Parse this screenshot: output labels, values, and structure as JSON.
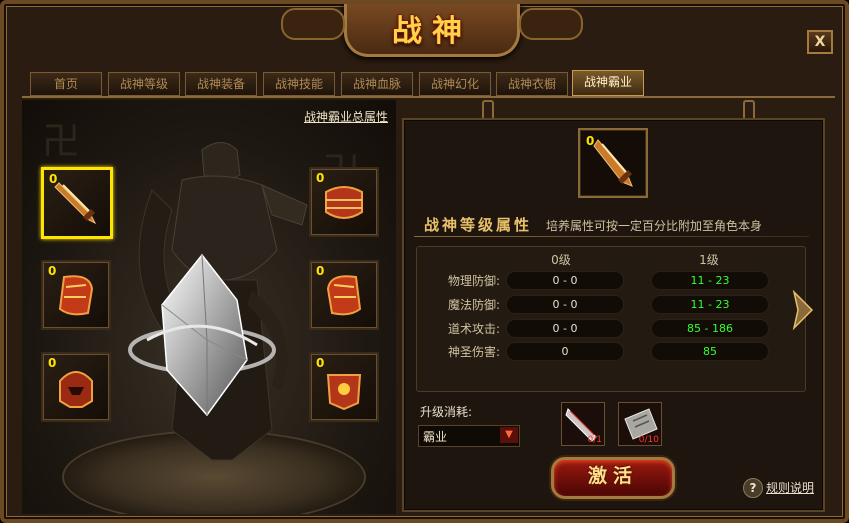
{
  "window": {
    "title": "战神",
    "close_label": "X"
  },
  "tabs": [
    {
      "label": "首页",
      "active": false
    },
    {
      "label": "战神等级",
      "active": false
    },
    {
      "label": "战神装备",
      "active": false
    },
    {
      "label": "战神技能",
      "active": false
    },
    {
      "label": "战神血脉",
      "active": false
    },
    {
      "label": "战神幻化",
      "active": false
    },
    {
      "label": "战神衣橱",
      "active": false
    },
    {
      "label": "战神霸业",
      "active": true
    }
  ],
  "left": {
    "total_attr_link": "战神霸业总属性",
    "slots": [
      {
        "name": "sword",
        "count": "0",
        "selected": true
      },
      {
        "name": "armor",
        "count": "0",
        "selected": false
      },
      {
        "name": "bracer-left",
        "count": "0",
        "selected": false
      },
      {
        "name": "bracer-right",
        "count": "0",
        "selected": false
      },
      {
        "name": "helmet",
        "count": "0",
        "selected": false
      },
      {
        "name": "belt",
        "count": "0",
        "selected": false
      }
    ]
  },
  "right": {
    "selected_item_count": "0",
    "section_title": "战神等级属性",
    "section_subtitle": "培养属性可按一定百分比附加至角色本身",
    "columns": [
      "0级",
      "1级"
    ],
    "rows": [
      {
        "label": "物理防御:",
        "current": "0 - 0",
        "next": "11 - 23"
      },
      {
        "label": "魔法防御:",
        "current": "0 - 0",
        "next": "11 - 23"
      },
      {
        "label": "道术攻击:",
        "current": "0 - 0",
        "next": "85 - 186"
      },
      {
        "label": "神圣伤害:",
        "current": "0",
        "next": "85"
      }
    ],
    "cost_label": "升级消耗:",
    "select_value": "霸业",
    "costs": [
      {
        "name": "blade-material",
        "amount": "0/1"
      },
      {
        "name": "stone-tablet",
        "amount": "0/10"
      }
    ],
    "activate_label": "激活",
    "help_label": "规则说明",
    "help_icon_glyph": "?"
  },
  "colors": {
    "highlight": "#ffe400",
    "gold": "#e8c06a",
    "next_value": "#33ff33",
    "frame": "#6b4a23"
  }
}
